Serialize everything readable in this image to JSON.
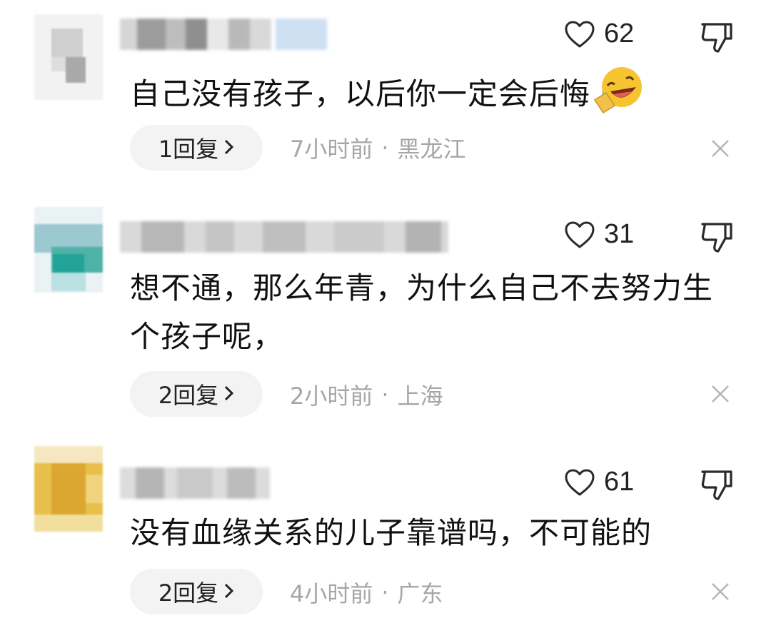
{
  "comments": [
    {
      "like_count": "62",
      "text": "自己没有孩子，以后你一定会后悔",
      "emoji": "rolling-laughing-emoji",
      "reply_label": "1回复",
      "time": "7小时前",
      "separator": "·",
      "location": "黑龙江"
    },
    {
      "like_count": "31",
      "text": "想不通，那么年青，为什么自己不去努力生个孩子呢，",
      "reply_label": "2回复",
      "time": "2小时前",
      "separator": "·",
      "location": "上海"
    },
    {
      "like_count": "61",
      "text": "没有血缘关系的儿子靠谱吗，不可能的",
      "reply_label": "2回复",
      "time": "4小时前",
      "separator": "·",
      "location": "广东"
    }
  ],
  "icons": {
    "like": "heart-outline-icon",
    "dislike": "thumbs-down-icon",
    "reply_arrow": "chevron-right-icon",
    "close": "close-icon"
  },
  "colors": {
    "text": "#111111",
    "meta": "#a6a6a6",
    "pill_bg": "#f3f3f3"
  }
}
